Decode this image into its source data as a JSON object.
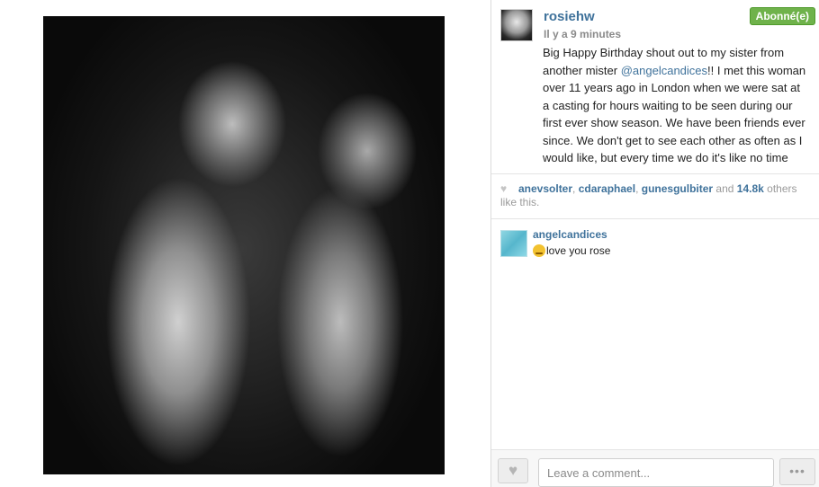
{
  "post": {
    "username": "rosiehw",
    "timestamp": "Il y a 9 minutes",
    "follow_label": "Abonné(e)",
    "caption_part1": "Big Happy Birthday shout out to my sister from another mister ",
    "caption_mention": "@angelcandices",
    "caption_part2": "!! I met this woman over 11 years ago in London when we were sat at a casting for hours waiting to be seen during our first ever show season. We have been friends ever since. We don't get to see each other as often as I would like, but every time we do it's like no time passed between us at all. You haven't changed a bit! You're still the realist, chillest,"
  },
  "likes": {
    "likers": [
      "anevsolter",
      "cdaraphael",
      "gunesgulbiter"
    ],
    "separator1": ", ",
    "separator2": ", ",
    "and_text": " and ",
    "count": "14.8k",
    "others_text": " others like this."
  },
  "comments": [
    {
      "user": "angelcandices",
      "text": "love you rose",
      "emoji": "smiling-face-emoji"
    }
  ],
  "footer": {
    "comment_placeholder": "Leave a comment...",
    "more_label": "•••",
    "like_icon": "heart-icon"
  },
  "colors": {
    "link": "#3f729b",
    "follow_green": "#6fb24b",
    "muted": "#8a8a8a"
  }
}
